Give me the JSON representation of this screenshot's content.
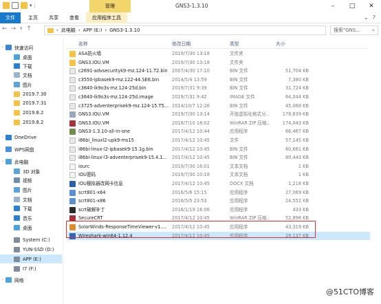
{
  "titlebar": {
    "manage_tab": "管理",
    "window_title": "GNS3-1.3.10",
    "min": "–",
    "max": "□",
    "close": "✕"
  },
  "ribbon": {
    "file": "文件",
    "home": "主页",
    "share": "共享",
    "view": "查看",
    "app_tools": "应用程序工具"
  },
  "address": {
    "crumbs": [
      "此电脑",
      "APP (E:)",
      "GNS3-1.3.10"
    ],
    "separator": "›",
    "search_placeholder": "搜索\"GNS..."
  },
  "sidebar": {
    "items": [
      {
        "label": "快速访问",
        "icon": "star-icon",
        "color": "#3a86d6"
      },
      {
        "label": "桌面",
        "icon": "desktop-icon",
        "color": "#4aa3df"
      },
      {
        "label": "下载",
        "icon": "download-icon",
        "color": "#2f7fd0"
      },
      {
        "label": "文档",
        "icon": "document-icon",
        "color": "#9cb5cf"
      },
      {
        "label": "图片",
        "icon": "picture-icon",
        "color": "#5ba4d9"
      },
      {
        "label": "2019.7.30",
        "icon": "folder-icon",
        "color": "#f5c343"
      },
      {
        "label": "2019.7.31",
        "icon": "folder-icon",
        "color": "#f5c343"
      },
      {
        "label": "2019.8.2",
        "icon": "folder-icon",
        "color": "#f5c343"
      },
      {
        "label": "2019.8.2",
        "icon": "folder-icon",
        "color": "#f5c343"
      },
      {
        "label": "OneDrive",
        "icon": "cloud-icon",
        "color": "#2f7fd0"
      },
      {
        "label": "WPS网盘",
        "icon": "cloud-icon",
        "color": "#4a90e2"
      },
      {
        "label": "此电脑",
        "icon": "computer-icon",
        "color": "#4aa3df"
      },
      {
        "label": "3D 对象",
        "icon": "cube-icon",
        "color": "#5ba4d9"
      },
      {
        "label": "视频",
        "icon": "video-icon",
        "color": "#6f8fb0"
      },
      {
        "label": "图片",
        "icon": "picture-icon",
        "color": "#5ba4d9"
      },
      {
        "label": "文档",
        "icon": "document-icon",
        "color": "#9cb5cf"
      },
      {
        "label": "下载",
        "icon": "download-icon",
        "color": "#2f7fd0"
      },
      {
        "label": "音乐",
        "icon": "music-icon",
        "color": "#2f7fd0"
      },
      {
        "label": "桌面",
        "icon": "desktop-icon",
        "color": "#4aa3df"
      },
      {
        "label": "System (C:)",
        "icon": "drive-icon",
        "color": "#7f8c99"
      },
      {
        "label": "YUN-SSD (D:)",
        "icon": "drive-icon",
        "color": "#7f8c99"
      },
      {
        "label": "APP (E:)",
        "icon": "drive-icon",
        "color": "#7f8c99"
      },
      {
        "label": "I7 (F:)",
        "icon": "drive-icon",
        "color": "#7f8c99"
      },
      {
        "label": "网络",
        "icon": "network-icon",
        "color": "#4aa3df"
      }
    ]
  },
  "columns": {
    "name": "名称",
    "date": "修改日期",
    "type": "类型",
    "size": "大小"
  },
  "files": [
    {
      "name": "ASA防火墙",
      "date": "2019/7/30 13:18",
      "type": "文件夹",
      "size": "",
      "icon": "folder-icon",
      "color": "#f5c343"
    },
    {
      "name": "GNS3.IOU.VM",
      "date": "2019/7/30 13:18",
      "type": "文件夹",
      "size": "",
      "icon": "folder-icon",
      "color": "#f5c343"
    },
    {
      "name": "c2691-advsecurityk9-mz.124-11.T2.bin",
      "date": "2007/4/30 17:10",
      "type": "BIN 文件",
      "size": "51,704 KB",
      "icon": "file-icon",
      "color": "#e8e8e8"
    },
    {
      "name": "c3550-ipbasek9-mz.122-44.SE6.bin",
      "date": "2014/5/4 13:59",
      "type": "BIN 文件",
      "size": "7,380 KB",
      "icon": "file-icon",
      "color": "#e8e8e8"
    },
    {
      "name": "c3640-ik9o3s-mz.124-25d.bin",
      "date": "2019/7/31 9:39",
      "type": "BIN 文件",
      "size": "31,724 KB",
      "icon": "file-icon",
      "color": "#e8e8e8"
    },
    {
      "name": "c3640-ik9o3s-mz.124-25d.image",
      "date": "2019/7/31 9:42",
      "type": "IMAGE 文件",
      "size": "64,044 KB",
      "icon": "file-icon",
      "color": "#e8e8e8"
    },
    {
      "name": "c3725-adventerprisek9-mz.124-15.T5...",
      "date": "2014/10/7 12:26",
      "type": "BIN 文件",
      "size": "45,068 KB",
      "icon": "file-icon",
      "color": "#e8e8e8"
    },
    {
      "name": "GNS3.IOU.VM",
      "date": "2019/7/30 13:14",
      "type": "开放虚拟化格式分...",
      "size": "178,639 KB",
      "icon": "vm-icon",
      "color": "#9aa8b8"
    },
    {
      "name": "GNS3.IOU.VM",
      "date": "2018/7/10 18:02",
      "type": "WinRAR ZIP 压缩...",
      "size": "174,043 KB",
      "icon": "zip-icon",
      "color": "#a7323a"
    },
    {
      "name": "GNS3-1.3.10-all-in-one",
      "date": "2017/4/12 10:44",
      "type": "应用程序",
      "size": "66,467 KB",
      "icon": "app-icon",
      "color": "#6c8f4e"
    },
    {
      "name": "i86bi_linuxl2-upk9-ms15",
      "date": "2017/4/12 10:45",
      "type": "文件",
      "size": "57,145 KB",
      "icon": "file-icon",
      "color": "#e8e8e8"
    },
    {
      "name": "i86bi-linux-l2-ipbasek9-15.1g.bin",
      "date": "2017/4/12 10:45",
      "type": "BIN 文件",
      "size": "60,681 KB",
      "icon": "file-icon",
      "color": "#e8e8e8"
    },
    {
      "name": "i86bi-linux-l3-adventerprisek9-15.4.1...",
      "date": "2017/4/12 10:45",
      "type": "BIN 文件",
      "size": "80,443 KB",
      "icon": "file-icon",
      "color": "#e8e8e8"
    },
    {
      "name": "iourc",
      "date": "2019/7/30 16:01",
      "type": "文本文档",
      "size": "1 KB",
      "icon": "text-file-icon",
      "color": "#f4f4f4"
    },
    {
      "name": "IOU密码",
      "date": "2019/7/30 10:18",
      "type": "文本文档",
      "size": "1 KB",
      "icon": "text-file-icon",
      "color": "#f4f4f4"
    },
    {
      "name": "IOU模拟器改网卡信息",
      "date": "2017/4/12 10:45",
      "type": "DOCX 文档",
      "size": "1,218 KB",
      "icon": "word-icon",
      "color": "#2b5fa8"
    },
    {
      "name": "scrt801-x64",
      "date": "2016/5/6 15:15",
      "type": "应用程序",
      "size": "27,069 KB",
      "icon": "app-icon",
      "color": "#5a8fd1"
    },
    {
      "name": "scrt801-x86",
      "date": "2016/5/5 23:53",
      "type": "应用程序",
      "size": "24,552 KB",
      "icon": "app-icon",
      "color": "#5a8fd1"
    },
    {
      "name": "scrt破解补丁",
      "date": "2016/1/19 16:06",
      "type": "应用程序",
      "size": "433 KB",
      "icon": "app-icon",
      "color": "#2a2a2a"
    },
    {
      "name": "SecureCRT",
      "date": "2017/4/12 10:45",
      "type": "WinRAR ZIP 压缩...",
      "size": "52,896 KB",
      "icon": "zip-icon",
      "color": "#a7323a"
    },
    {
      "name": "SolarWinds-ResponseTimeViewer-v1....",
      "date": "2017/4/12 10:45",
      "type": "应用程序",
      "size": "43,319 KB",
      "icon": "app-icon",
      "color": "#e08a2e"
    },
    {
      "name": "Wireshark-win64-1.12.4",
      "date": "2017/4/12 10:45",
      "type": "应用程序",
      "size": "29,137 KB",
      "icon": "wireshark-icon",
      "color": "#2a66c2",
      "selected": true
    }
  ],
  "watermark": "@51CTO博客"
}
